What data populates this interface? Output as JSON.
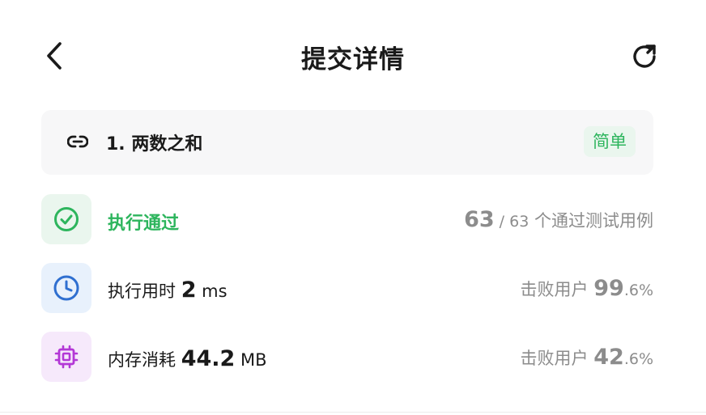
{
  "header": {
    "title": "提交详情",
    "back_icon": "chevron-left-icon",
    "refresh_icon": "refresh-icon"
  },
  "problem": {
    "icon": "link-icon",
    "title": "1. 两数之和",
    "difficulty": "简单",
    "difficulty_color": "#2db55d"
  },
  "result": {
    "icon": "check-circle-icon",
    "status": "执行通过",
    "status_color": "#2db55d",
    "passed": "63",
    "separator": " / ",
    "total": "63",
    "suffix": " 个通过测试用例"
  },
  "runtime": {
    "icon": "clock-icon",
    "label": "执行用时 ",
    "value": "2",
    "unit": " ms",
    "beat_label": "击败用户 ",
    "beat_int": "99",
    "beat_dec": ".6%"
  },
  "memory": {
    "icon": "chip-icon",
    "label": "内存消耗 ",
    "value": "44.2",
    "unit": " MB",
    "beat_label": "击败用户 ",
    "beat_int": "42",
    "beat_dec": ".6%"
  }
}
